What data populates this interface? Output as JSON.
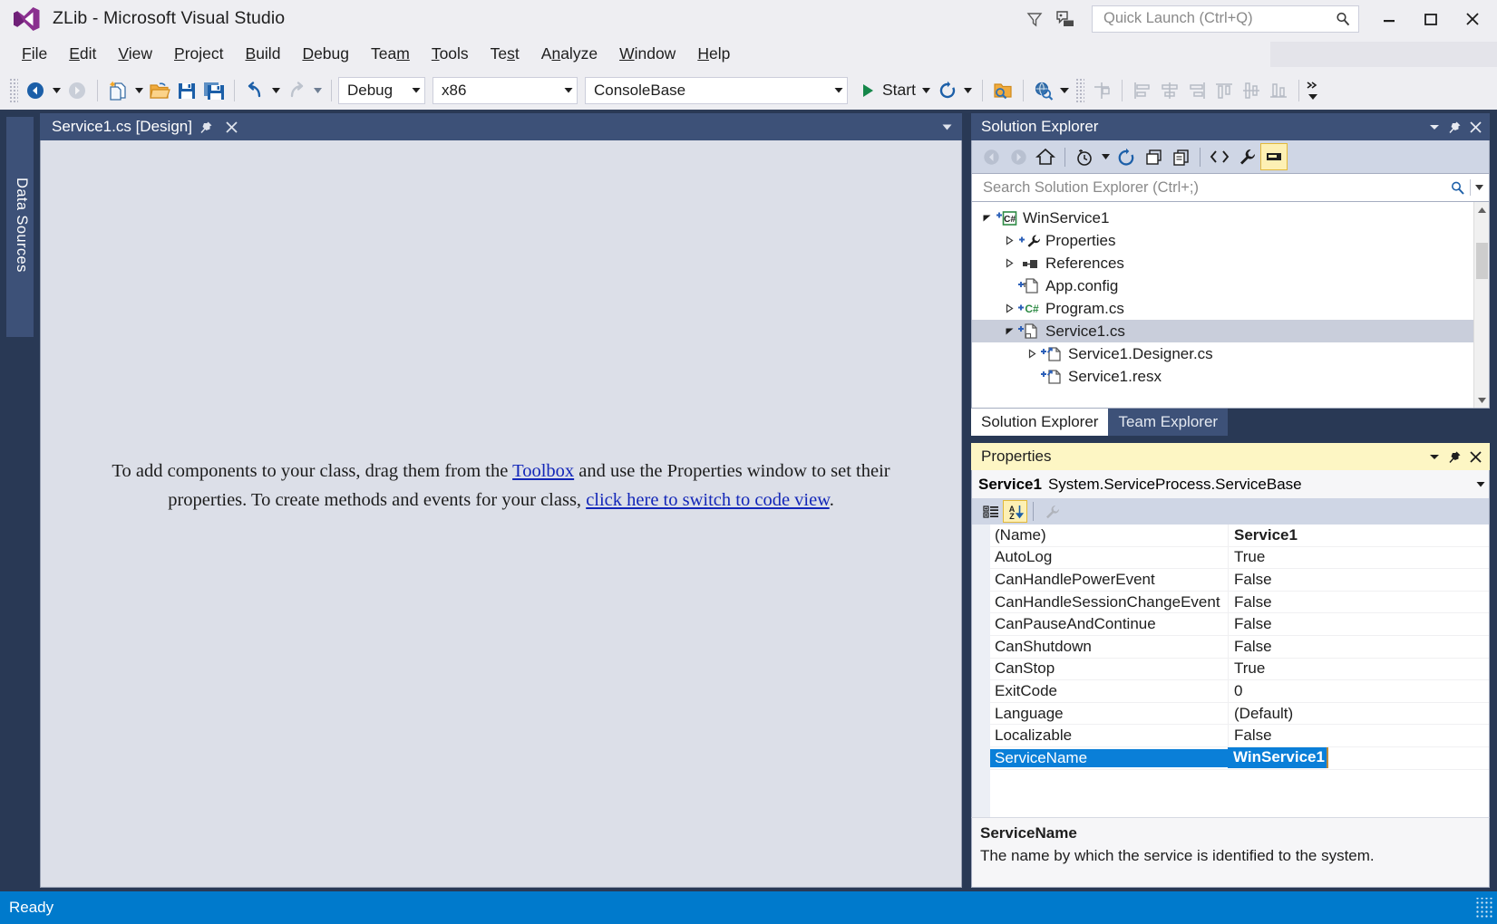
{
  "window": {
    "title": "ZLib - Microsoft Visual Studio",
    "logo_icon": "visual-studio-logo-icon",
    "minimize_icon": "minimize-icon",
    "maximize_icon": "maximize-icon",
    "close_icon": "close-icon",
    "feedback_icon": "feedback-icon",
    "filter_icon": "filter-icon"
  },
  "quick_launch": {
    "placeholder": "Quick Launch (Ctrl+Q)",
    "value": "",
    "search_icon": "search-icon"
  },
  "menu": {
    "items": [
      {
        "label": "File",
        "accel": "F"
      },
      {
        "label": "Edit",
        "accel": "E"
      },
      {
        "label": "View",
        "accel": "V"
      },
      {
        "label": "Project",
        "accel": "P"
      },
      {
        "label": "Build",
        "accel": "B"
      },
      {
        "label": "Debug",
        "accel": "D"
      },
      {
        "label": "Team",
        "accel": "m"
      },
      {
        "label": "Tools",
        "accel": "T"
      },
      {
        "label": "Test",
        "accel": "s"
      },
      {
        "label": "Analyze",
        "accel": "N"
      },
      {
        "label": "Window",
        "accel": "W"
      },
      {
        "label": "Help",
        "accel": "H"
      }
    ]
  },
  "toolbar": {
    "navigate_back": "navigate-back-icon",
    "navigate_forward": "navigate-forward-icon",
    "new_project": "new-project-icon",
    "open_file": "open-file-icon",
    "save": "save-icon",
    "save_all": "save-all-icon",
    "undo": "undo-icon",
    "redo": "redo-icon",
    "configuration": {
      "value": "Debug",
      "label": "Debug"
    },
    "platform": {
      "value": "x86",
      "label": "x86"
    },
    "startup_project": {
      "value": "ConsoleBase",
      "label": "ConsoleBase"
    },
    "start_label": "Start",
    "start_icon": "play-icon",
    "restart_icon": "restart-icon",
    "solution_explorer_icon": "find-in-files-icon",
    "object_browser_icon": "object-browser-icon",
    "align_to_grid_icon": "align-to-grid-icon",
    "align_lefts_icon": "align-lefts-icon",
    "align_centers_icon": "align-centers-icon",
    "align_rights_icon": "align-rights-icon",
    "align_tops_icon": "align-tops-icon",
    "align_middles_icon": "align-middles-icon",
    "align_bottoms_icon": "align-bottoms-icon",
    "overflow_icon": "toolbar-overflow-icon"
  },
  "left_dock": {
    "tab_label": "Data Sources"
  },
  "document": {
    "tab_label": "Service1.cs [Design]",
    "pin_icon": "pin-icon",
    "close_icon": "close-icon",
    "tab_list_icon": "tab-list-chevron-icon",
    "designer_message": {
      "part1": "To add components to your class, drag them from the ",
      "link1": "Toolbox",
      "part2": " and use the Properties window to set their properties. To create methods and events for your class, ",
      "link2": "click here to switch to code view",
      "part3": "."
    }
  },
  "solution_explorer": {
    "title": "Solution Explorer",
    "dropdown_icon": "chevron-down-icon",
    "pin_icon": "pin-icon",
    "close_icon": "close-icon",
    "toolbar": {
      "back_icon": "back-circle-icon",
      "forward_icon": "forward-circle-icon",
      "home_icon": "home-icon",
      "pending_changes_icon": "pending-changes-clock-icon",
      "pending_changes_caret": "chevron-down-icon",
      "refresh_icon": "refresh-icon",
      "collapse_all_icon": "collapse-all-icon",
      "show_all_files_icon": "show-all-files-icon",
      "view_code_icon": "view-code-icon",
      "properties_icon": "wrench-icon",
      "preview_icon": "preview-selected-items-icon"
    },
    "search": {
      "placeholder": "Search Solution Explorer (Ctrl+;)",
      "value": "",
      "search_icon": "search-icon",
      "filter_caret_icon": "chevron-down-icon"
    },
    "tree": [
      {
        "label": "WinService1",
        "indent": 0,
        "twisty": "expanded",
        "icon": "csharp-project-icon",
        "overlay": "pending-add-icon",
        "selected": false
      },
      {
        "label": "Properties",
        "indent": 1,
        "twisty": "collapsed",
        "icon": "wrench-icon",
        "overlay": "pending-add-icon",
        "selected": false
      },
      {
        "label": "References",
        "indent": 1,
        "twisty": "collapsed",
        "icon": "references-icon",
        "overlay": "",
        "selected": false
      },
      {
        "label": "App.config",
        "indent": 1,
        "twisty": "none",
        "icon": "config-file-icon",
        "overlay": "pending-add-icon",
        "selected": false
      },
      {
        "label": "Program.cs",
        "indent": 1,
        "twisty": "collapsed",
        "icon": "csharp-file-icon",
        "overlay": "pending-add-icon",
        "selected": false
      },
      {
        "label": "Service1.cs",
        "indent": 1,
        "twisty": "expanded",
        "icon": "component-file-icon",
        "overlay": "pending-add-icon",
        "selected": true
      },
      {
        "label": "Service1.Designer.cs",
        "indent": 2,
        "twisty": "collapsed",
        "icon": "designer-file-icon",
        "overlay": "pending-add-icon",
        "selected": false
      },
      {
        "label": "Service1.resx",
        "indent": 2,
        "twisty": "none",
        "icon": "designer-file-icon",
        "overlay": "pending-add-icon",
        "selected": false
      }
    ],
    "scroll_up_icon": "scroll-up-arrow-icon",
    "scroll_down_icon": "scroll-down-arrow-icon"
  },
  "bottom_tabs": [
    {
      "label": "Solution Explorer",
      "active": true
    },
    {
      "label": "Team Explorer",
      "active": false
    }
  ],
  "properties": {
    "title": "Properties",
    "dropdown_icon": "chevron-down-icon",
    "pin_icon": "pin-icon",
    "close_icon": "close-icon",
    "object_name": "Service1",
    "object_type": "System.ServiceProcess.ServiceBase",
    "object_caret_icon": "chevron-down-icon",
    "toolbar": {
      "categorized_icon": "categorized-view-icon",
      "alphabetical_icon": "alphabetical-sort-icon",
      "events_icon": "events-wrench-icon"
    },
    "rows": [
      {
        "name": "(Name)",
        "value": "Service1",
        "bold": true,
        "selected": false
      },
      {
        "name": "AutoLog",
        "value": "True",
        "bold": false,
        "selected": false
      },
      {
        "name": "CanHandlePowerEvent",
        "value": "False",
        "bold": false,
        "selected": false
      },
      {
        "name": "CanHandleSessionChangeEvent",
        "value": "False",
        "bold": false,
        "selected": false
      },
      {
        "name": "CanPauseAndContinue",
        "value": "False",
        "bold": false,
        "selected": false
      },
      {
        "name": "CanShutdown",
        "value": "False",
        "bold": false,
        "selected": false
      },
      {
        "name": "CanStop",
        "value": "True",
        "bold": false,
        "selected": false
      },
      {
        "name": "ExitCode",
        "value": "0",
        "bold": false,
        "selected": false
      },
      {
        "name": "Language",
        "value": "(Default)",
        "bold": false,
        "selected": false
      },
      {
        "name": "Localizable",
        "value": "False",
        "bold": false,
        "selected": false
      },
      {
        "name": "ServiceName",
        "value": "WinService1",
        "bold": false,
        "selected": true
      }
    ],
    "description": {
      "title": "ServiceName",
      "text": "The name by which the service is identified to the system."
    }
  },
  "statusbar": {
    "text": "Ready"
  },
  "colors": {
    "accent_blue": "#007acc",
    "chrome_dark": "#293955",
    "panel_header": "#3d5178",
    "properties_header": "#fdf6c4",
    "selection_blue": "#0a7fd8",
    "tree_selection": "#c9cedb"
  }
}
